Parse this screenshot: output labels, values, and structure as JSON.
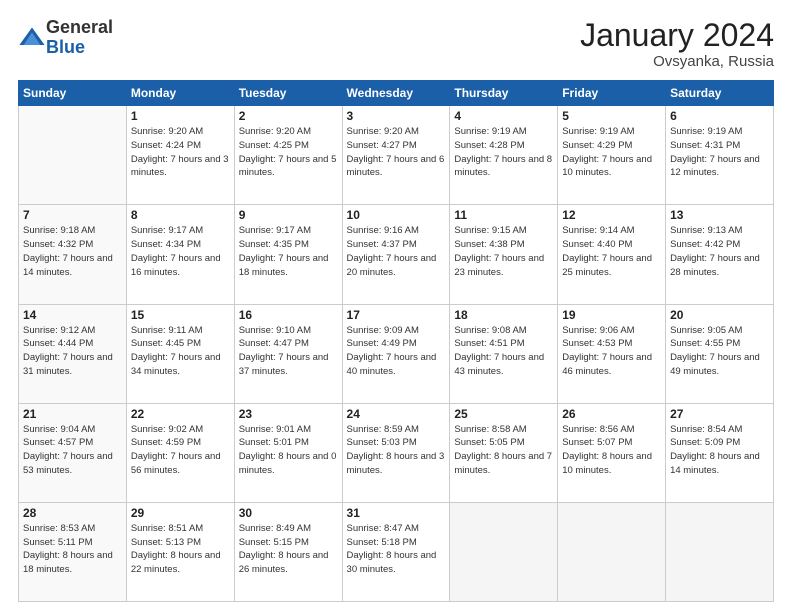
{
  "logo": {
    "general": "General",
    "blue": "Blue"
  },
  "title": "January 2024",
  "location": "Ovsyanka, Russia",
  "days_header": [
    "Sunday",
    "Monday",
    "Tuesday",
    "Wednesday",
    "Thursday",
    "Friday",
    "Saturday"
  ],
  "weeks": [
    [
      {
        "day": "",
        "sunrise": "",
        "sunset": "",
        "daylight": "",
        "empty": true
      },
      {
        "day": "1",
        "sunrise": "Sunrise: 9:20 AM",
        "sunset": "Sunset: 4:24 PM",
        "daylight": "Daylight: 7 hours and 3 minutes."
      },
      {
        "day": "2",
        "sunrise": "Sunrise: 9:20 AM",
        "sunset": "Sunset: 4:25 PM",
        "daylight": "Daylight: 7 hours and 5 minutes."
      },
      {
        "day": "3",
        "sunrise": "Sunrise: 9:20 AM",
        "sunset": "Sunset: 4:27 PM",
        "daylight": "Daylight: 7 hours and 6 minutes."
      },
      {
        "day": "4",
        "sunrise": "Sunrise: 9:19 AM",
        "sunset": "Sunset: 4:28 PM",
        "daylight": "Daylight: 7 hours and 8 minutes."
      },
      {
        "day": "5",
        "sunrise": "Sunrise: 9:19 AM",
        "sunset": "Sunset: 4:29 PM",
        "daylight": "Daylight: 7 hours and 10 minutes."
      },
      {
        "day": "6",
        "sunrise": "Sunrise: 9:19 AM",
        "sunset": "Sunset: 4:31 PM",
        "daylight": "Daylight: 7 hours and 12 minutes."
      }
    ],
    [
      {
        "day": "7",
        "sunrise": "Sunrise: 9:18 AM",
        "sunset": "Sunset: 4:32 PM",
        "daylight": "Daylight: 7 hours and 14 minutes."
      },
      {
        "day": "8",
        "sunrise": "Sunrise: 9:17 AM",
        "sunset": "Sunset: 4:34 PM",
        "daylight": "Daylight: 7 hours and 16 minutes."
      },
      {
        "day": "9",
        "sunrise": "Sunrise: 9:17 AM",
        "sunset": "Sunset: 4:35 PM",
        "daylight": "Daylight: 7 hours and 18 minutes."
      },
      {
        "day": "10",
        "sunrise": "Sunrise: 9:16 AM",
        "sunset": "Sunset: 4:37 PM",
        "daylight": "Daylight: 7 hours and 20 minutes."
      },
      {
        "day": "11",
        "sunrise": "Sunrise: 9:15 AM",
        "sunset": "Sunset: 4:38 PM",
        "daylight": "Daylight: 7 hours and 23 minutes."
      },
      {
        "day": "12",
        "sunrise": "Sunrise: 9:14 AM",
        "sunset": "Sunset: 4:40 PM",
        "daylight": "Daylight: 7 hours and 25 minutes."
      },
      {
        "day": "13",
        "sunrise": "Sunrise: 9:13 AM",
        "sunset": "Sunset: 4:42 PM",
        "daylight": "Daylight: 7 hours and 28 minutes."
      }
    ],
    [
      {
        "day": "14",
        "sunrise": "Sunrise: 9:12 AM",
        "sunset": "Sunset: 4:44 PM",
        "daylight": "Daylight: 7 hours and 31 minutes."
      },
      {
        "day": "15",
        "sunrise": "Sunrise: 9:11 AM",
        "sunset": "Sunset: 4:45 PM",
        "daylight": "Daylight: 7 hours and 34 minutes."
      },
      {
        "day": "16",
        "sunrise": "Sunrise: 9:10 AM",
        "sunset": "Sunset: 4:47 PM",
        "daylight": "Daylight: 7 hours and 37 minutes."
      },
      {
        "day": "17",
        "sunrise": "Sunrise: 9:09 AM",
        "sunset": "Sunset: 4:49 PM",
        "daylight": "Daylight: 7 hours and 40 minutes."
      },
      {
        "day": "18",
        "sunrise": "Sunrise: 9:08 AM",
        "sunset": "Sunset: 4:51 PM",
        "daylight": "Daylight: 7 hours and 43 minutes."
      },
      {
        "day": "19",
        "sunrise": "Sunrise: 9:06 AM",
        "sunset": "Sunset: 4:53 PM",
        "daylight": "Daylight: 7 hours and 46 minutes."
      },
      {
        "day": "20",
        "sunrise": "Sunrise: 9:05 AM",
        "sunset": "Sunset: 4:55 PM",
        "daylight": "Daylight: 7 hours and 49 minutes."
      }
    ],
    [
      {
        "day": "21",
        "sunrise": "Sunrise: 9:04 AM",
        "sunset": "Sunset: 4:57 PM",
        "daylight": "Daylight: 7 hours and 53 minutes."
      },
      {
        "day": "22",
        "sunrise": "Sunrise: 9:02 AM",
        "sunset": "Sunset: 4:59 PM",
        "daylight": "Daylight: 7 hours and 56 minutes."
      },
      {
        "day": "23",
        "sunrise": "Sunrise: 9:01 AM",
        "sunset": "Sunset: 5:01 PM",
        "daylight": "Daylight: 8 hours and 0 minutes."
      },
      {
        "day": "24",
        "sunrise": "Sunrise: 8:59 AM",
        "sunset": "Sunset: 5:03 PM",
        "daylight": "Daylight: 8 hours and 3 minutes."
      },
      {
        "day": "25",
        "sunrise": "Sunrise: 8:58 AM",
        "sunset": "Sunset: 5:05 PM",
        "daylight": "Daylight: 8 hours and 7 minutes."
      },
      {
        "day": "26",
        "sunrise": "Sunrise: 8:56 AM",
        "sunset": "Sunset: 5:07 PM",
        "daylight": "Daylight: 8 hours and 10 minutes."
      },
      {
        "day": "27",
        "sunrise": "Sunrise: 8:54 AM",
        "sunset": "Sunset: 5:09 PM",
        "daylight": "Daylight: 8 hours and 14 minutes."
      }
    ],
    [
      {
        "day": "28",
        "sunrise": "Sunrise: 8:53 AM",
        "sunset": "Sunset: 5:11 PM",
        "daylight": "Daylight: 8 hours and 18 minutes."
      },
      {
        "day": "29",
        "sunrise": "Sunrise: 8:51 AM",
        "sunset": "Sunset: 5:13 PM",
        "daylight": "Daylight: 8 hours and 22 minutes."
      },
      {
        "day": "30",
        "sunrise": "Sunrise: 8:49 AM",
        "sunset": "Sunset: 5:15 PM",
        "daylight": "Daylight: 8 hours and 26 minutes."
      },
      {
        "day": "31",
        "sunrise": "Sunrise: 8:47 AM",
        "sunset": "Sunset: 5:18 PM",
        "daylight": "Daylight: 8 hours and 30 minutes."
      },
      {
        "day": "",
        "sunrise": "",
        "sunset": "",
        "daylight": "",
        "empty": true
      },
      {
        "day": "",
        "sunrise": "",
        "sunset": "",
        "daylight": "",
        "empty": true
      },
      {
        "day": "",
        "sunrise": "",
        "sunset": "",
        "daylight": "",
        "empty": true
      }
    ]
  ]
}
